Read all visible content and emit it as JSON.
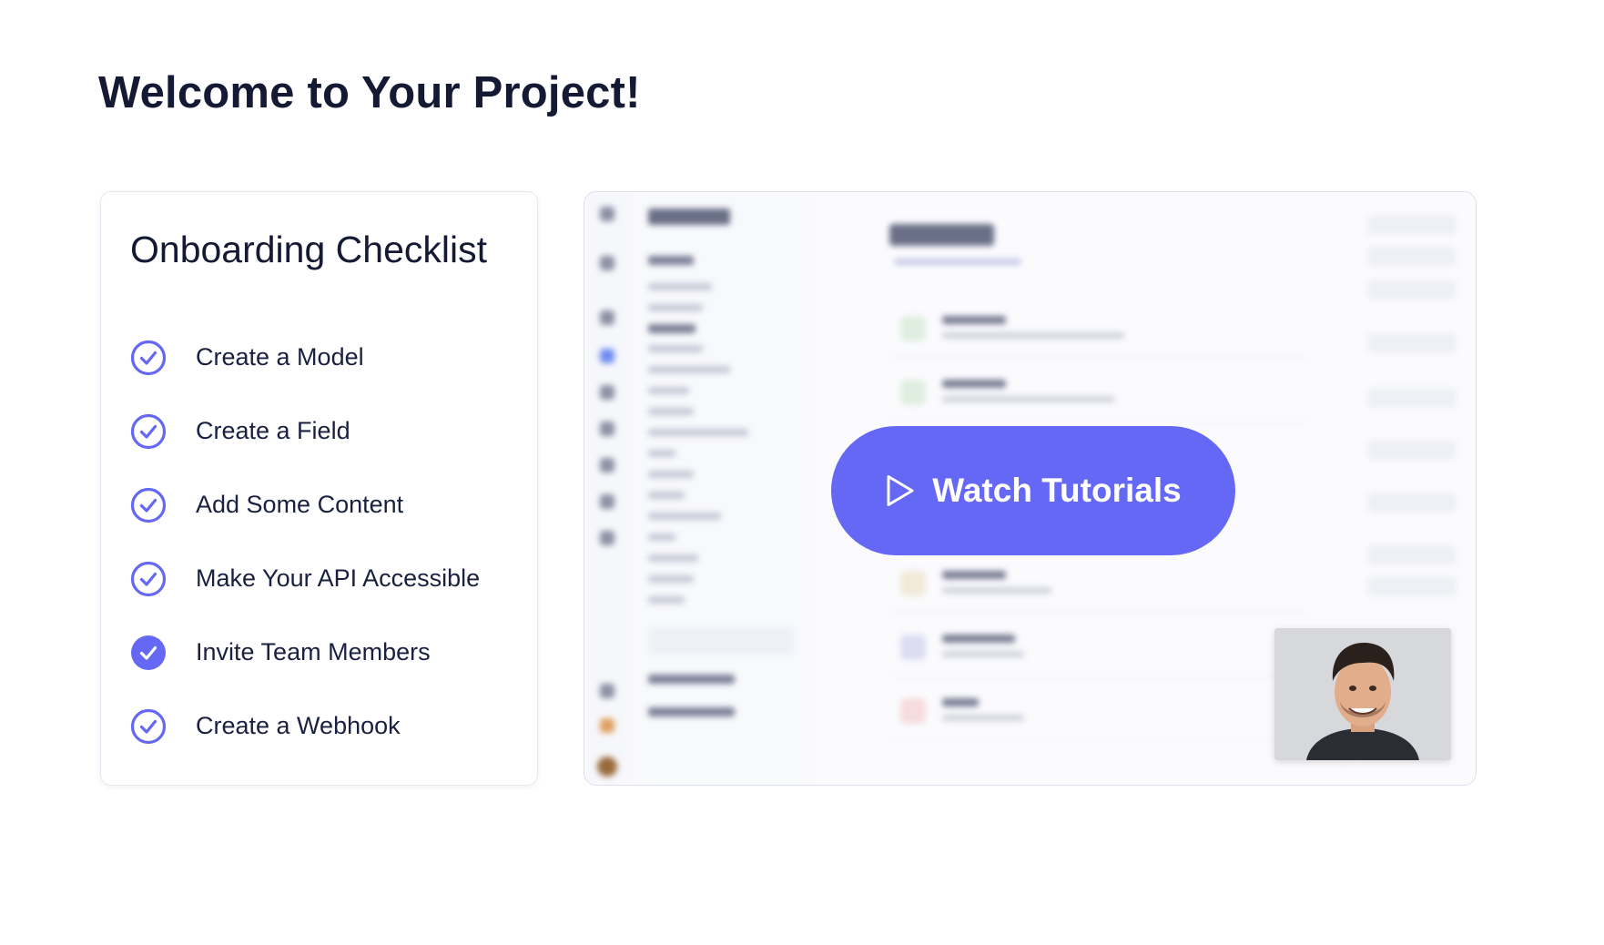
{
  "page": {
    "title": "Welcome to Your Project!"
  },
  "checklist": {
    "title": "Onboarding Checklist",
    "items": [
      {
        "label": "Create a Model",
        "icon": "check-circle-outline-icon"
      },
      {
        "label": "Create a Field",
        "icon": "check-circle-outline-icon"
      },
      {
        "label": "Add Some Content",
        "icon": "check-circle-outline-icon"
      },
      {
        "label": "Make Your API Accessible",
        "icon": "check-circle-outline-icon"
      },
      {
        "label": "Invite Team Members",
        "icon": "check-circle-filled-icon"
      },
      {
        "label": "Create a Webhook",
        "icon": "check-circle-outline-icon"
      }
    ]
  },
  "video": {
    "button_label": "Watch Tutorials",
    "button_icon": "play-icon"
  },
  "colors": {
    "accent": "#6568f5",
    "title": "#141a33",
    "text": "#1a2140"
  }
}
